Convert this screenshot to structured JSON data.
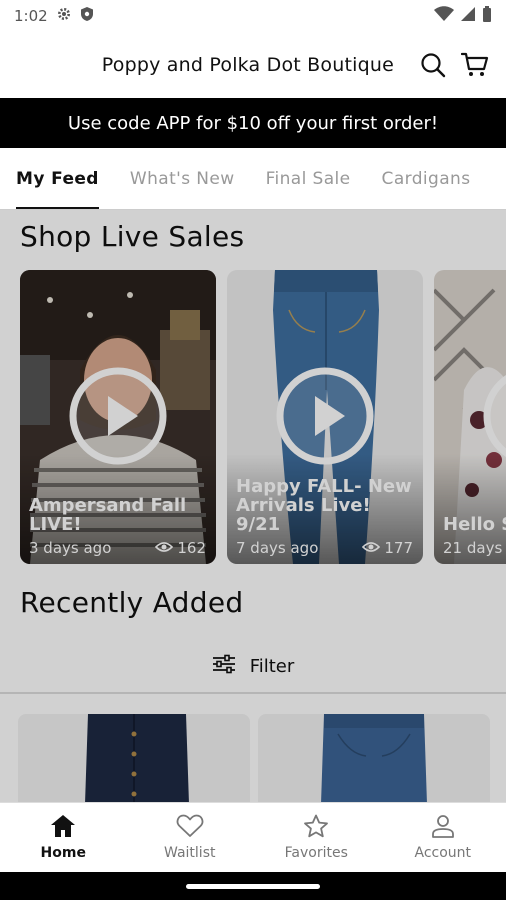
{
  "status_bar": {
    "time": "1:02"
  },
  "header": {
    "title": "Poppy and Polka Dot Boutique",
    "search_icon": "search-icon",
    "cart_icon": "cart-icon"
  },
  "promo": {
    "text": "Use code APP for $10 off your first order!"
  },
  "tabs": [
    {
      "label": "My Feed",
      "active": true
    },
    {
      "label": "What's New"
    },
    {
      "label": "Final Sale"
    },
    {
      "label": "Cardigans"
    }
  ],
  "live_sales": {
    "title": "Shop Live Sales",
    "cards": [
      {
        "title": "Ampersand Fall LIVE!",
        "time": "3 days ago",
        "views": "162"
      },
      {
        "title": "Happy FALL- New Arrivals Live! 9/21",
        "time": "7 days ago",
        "views": "177"
      },
      {
        "title": "Hello S",
        "time": "21 days"
      }
    ]
  },
  "recently_added": {
    "title": "Recently Added",
    "filter_label": "Filter"
  },
  "bottom_nav": [
    {
      "label": "Home",
      "icon": "home-icon",
      "active": true
    },
    {
      "label": "Waitlist",
      "icon": "heart-icon"
    },
    {
      "label": "Favorites",
      "icon": "star-icon"
    },
    {
      "label": "Account",
      "icon": "person-icon"
    }
  ],
  "colors": {
    "banner_bg": "#000000",
    "accent": "#111111"
  }
}
